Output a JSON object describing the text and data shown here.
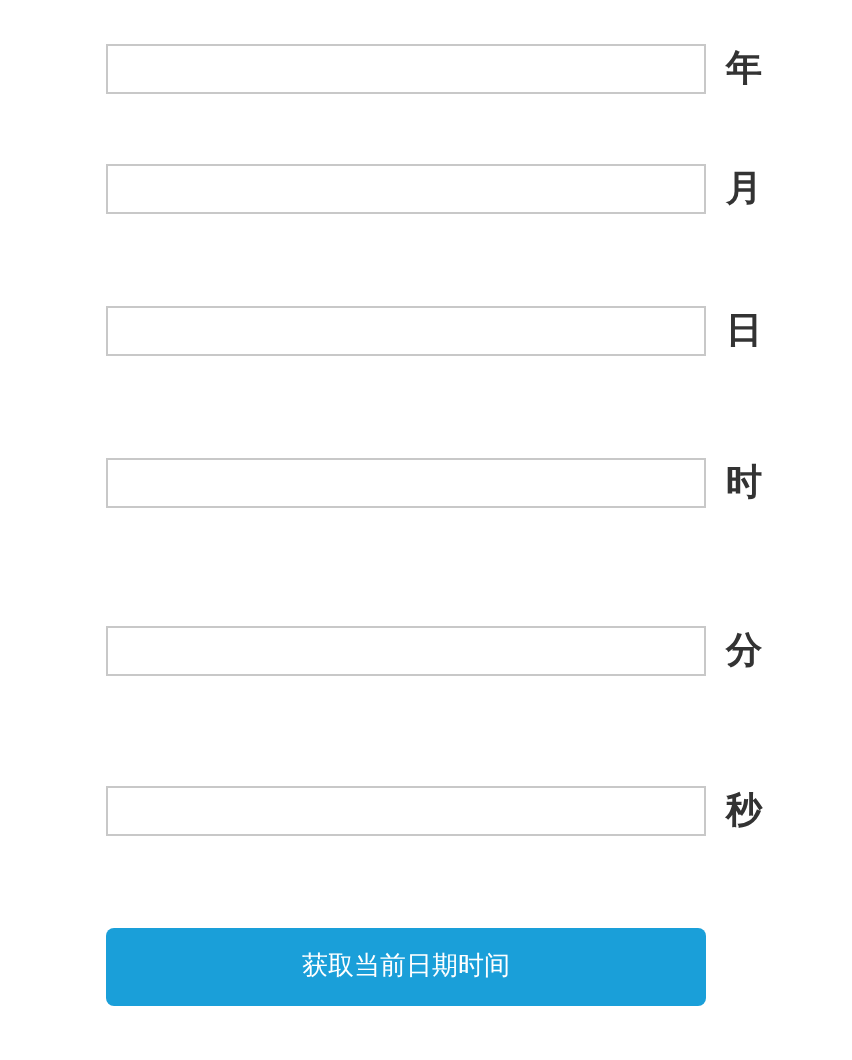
{
  "fields": [
    {
      "label": "年"
    },
    {
      "label": "月"
    },
    {
      "label": "日"
    },
    {
      "label": "时"
    },
    {
      "label": "分"
    },
    {
      "label": "秒"
    }
  ],
  "button": {
    "label": "获取当前日期时间"
  }
}
